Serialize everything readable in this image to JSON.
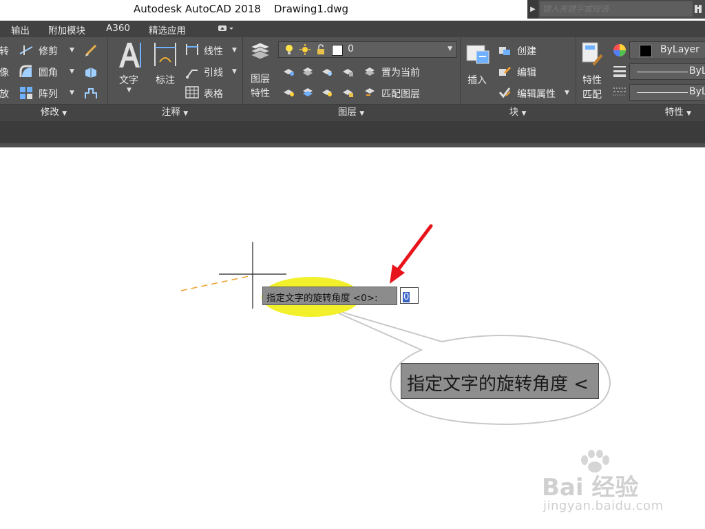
{
  "title": {
    "app": "Autodesk AutoCAD 2018",
    "file": "Drawing1.dwg"
  },
  "search": {
    "placeholder": "键入关键字或短语"
  },
  "menu_tabs": [
    "输出",
    "附加模块",
    "A360",
    "精选应用"
  ],
  "ribbon": {
    "modify": {
      "items": [
        "转",
        "像",
        "放",
        "修剪",
        "圆角",
        "阵列"
      ],
      "footer": "修改"
    },
    "annotation": {
      "text_label": "文字",
      "dim_label": "标注",
      "linear_label": "线性",
      "leader_label": "引线",
      "table_label": "表格",
      "footer": "注释"
    },
    "layers": {
      "properties_label_1": "图层",
      "properties_label_2": "特性",
      "current_layer": "0",
      "set_current_label": "置为当前",
      "match_layer_label": "匹配图层",
      "footer": "图层"
    },
    "block": {
      "insert_label": "插入",
      "create_label": "创建",
      "edit_label": "编辑",
      "edit_attr_label": "编辑属性",
      "footer": "块"
    },
    "properties": {
      "match_label_1": "特性",
      "match_label_2": "匹配",
      "color_value": "ByLayer",
      "linetype_value": "ByL",
      "lineweight_value": "ByL",
      "footer": "特性"
    }
  },
  "drawing": {
    "prompt": "指定文字的旋转角度 <0>:",
    "input_value": "0",
    "zoom_label": "指定文字的旋转角度 <"
  },
  "watermark": {
    "main": "Bai 经验",
    "sub": "jingyan.baidu.com"
  },
  "colors": {
    "ribbon_bg": "#535353",
    "menu_bg": "#424242",
    "highlight_ellipse": "#f2f02a",
    "arrow_red": "#e8141b",
    "dashed_line": "#f0a030"
  }
}
